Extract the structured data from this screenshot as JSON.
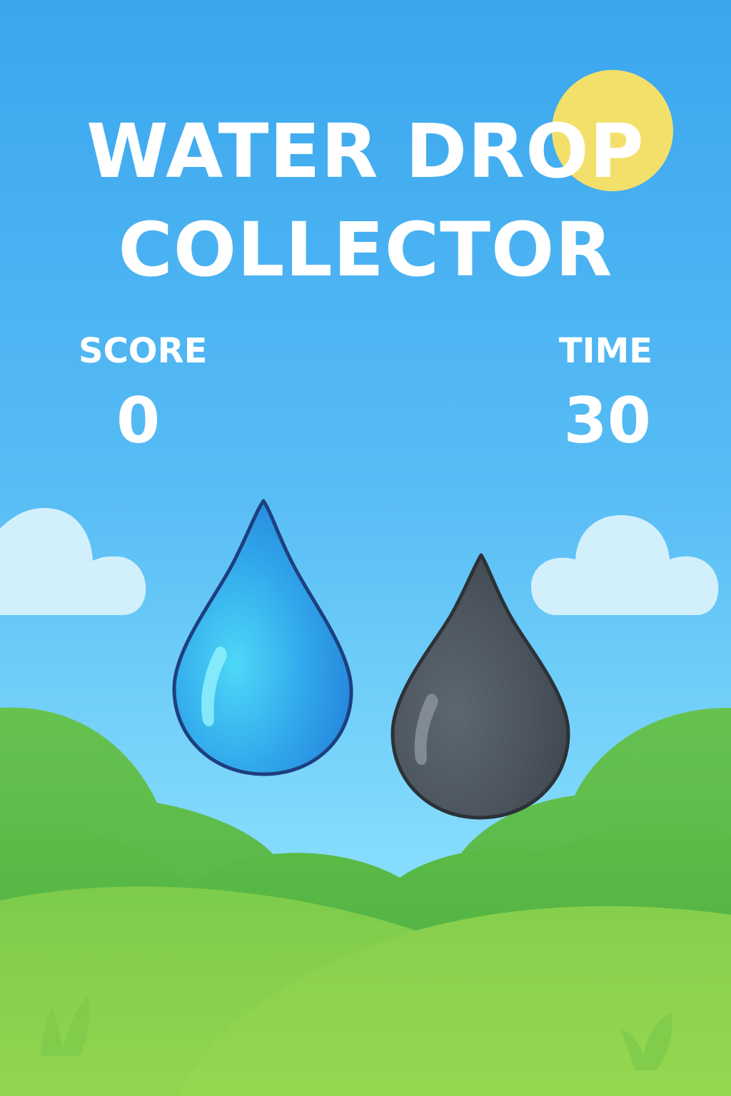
{
  "game": {
    "title_line_1": "WATER DROP",
    "title_line_2": "COLLECTOR"
  },
  "hud": {
    "score_label": "SCORE",
    "score_value": "0",
    "time_label": "TIME",
    "time_value": "30"
  },
  "sprites": {
    "clean_drop_icon": "water-drop-icon",
    "dirty_drop_icon": "oil-drop-icon",
    "sun_icon": "sun-icon",
    "cloud_icon": "cloud-icon"
  },
  "colors": {
    "sky_top": "#3aa6ee",
    "sky_bottom": "#85dcfc",
    "sun": "#f3e06a",
    "cloud": "#d2f0fc",
    "hill_dark": "#58b948",
    "hill_light": "#8ed44e",
    "clean_drop": "#2e9ae6",
    "clean_drop_outline": "#1d3f7e",
    "dirty_drop": "#4a535c",
    "dirty_drop_outline": "#2c3237",
    "text": "#ffffff"
  }
}
